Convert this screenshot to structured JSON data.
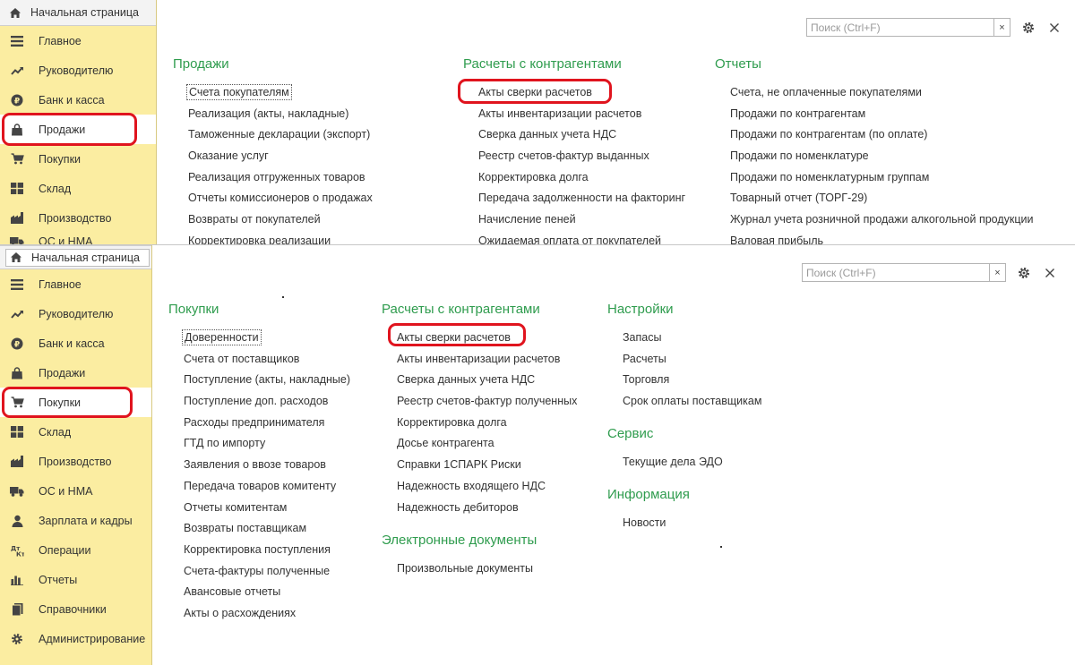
{
  "common": {
    "home_label": "Начальная страница",
    "search_placeholder": "Поиск (Ctrl+F)",
    "clear_glyph": "×",
    "accent_green": "#2f9c4e",
    "sidebar_bg": "#fbeda1",
    "highlight_red": "#e0141e"
  },
  "top": {
    "sidebar": [
      {
        "label": "Главное",
        "icon": "menu-icon"
      },
      {
        "label": "Руководителю",
        "icon": "trend-icon"
      },
      {
        "label": "Банк и касса",
        "icon": "coin-icon"
      },
      {
        "label": "Продажи",
        "icon": "shopping-bag-icon",
        "active": true
      },
      {
        "label": "Покупки",
        "icon": "cart-icon"
      },
      {
        "label": "Склад",
        "icon": "warehouse-icon"
      },
      {
        "label": "Производство",
        "icon": "factory-icon"
      },
      {
        "label": "ОС и НМА",
        "icon": "truck-icon"
      }
    ],
    "sections": [
      {
        "title": "Продажи",
        "links": [
          "Счета покупателям",
          "Реализация (акты, накладные)",
          "Таможенные декларации (экспорт)",
          "Оказание услуг",
          "Реализация отгруженных товаров",
          "Отчеты комиссионеров о продажах",
          "Возвраты от покупателей",
          "Корректировка реализации"
        ]
      },
      {
        "title": "Расчеты с контрагентами",
        "links": [
          "Акты сверки расчетов",
          "Акты инвентаризации расчетов",
          "Сверка данных учета НДС",
          "Реестр счетов-фактур выданных",
          "Корректировка долга",
          "Передача задолженности на факторинг",
          "Начисление пеней",
          "Ожидаемая оплата от покупателей"
        ]
      },
      {
        "title": "Отчеты",
        "links": [
          "Счета, не оплаченные покупателями",
          "Продажи по контрагентам",
          "Продажи по контрагентам (по оплате)",
          "Продажи по номенклатуре",
          "Продажи по номенклатурным группам",
          "Товарный отчет (ТОРГ-29)",
          "Журнал учета розничной продажи алкогольной продукции",
          "Валовая прибыль"
        ]
      }
    ]
  },
  "bottom": {
    "sidebar": [
      {
        "label": "Главное",
        "icon": "menu-icon"
      },
      {
        "label": "Руководителю",
        "icon": "trend-icon"
      },
      {
        "label": "Банк и касса",
        "icon": "coin-icon"
      },
      {
        "label": "Продажи",
        "icon": "shopping-bag-icon"
      },
      {
        "label": "Покупки",
        "icon": "cart-icon",
        "active": true
      },
      {
        "label": "Склад",
        "icon": "warehouse-icon"
      },
      {
        "label": "Производство",
        "icon": "factory-icon"
      },
      {
        "label": "ОС и НМА",
        "icon": "truck-icon"
      },
      {
        "label": "Зарплата и кадры",
        "icon": "person-icon"
      },
      {
        "label": "Операции",
        "icon": "debit-credit-icon"
      },
      {
        "label": "Отчеты",
        "icon": "bar-chart-icon"
      },
      {
        "label": "Справочники",
        "icon": "book-icon"
      },
      {
        "label": "Администрирование",
        "icon": "settings-icon"
      }
    ],
    "sections": [
      {
        "title": "Покупки",
        "links": [
          "Доверенности",
          "Счета от поставщиков",
          "Поступление (акты, накладные)",
          "Поступление доп. расходов",
          "Расходы предпринимателя",
          "ГТД по импорту",
          "Заявления о ввозе товаров",
          "Передача товаров комитенту",
          "Отчеты комитентам",
          "Возвраты поставщикам",
          "Корректировка поступления",
          "Счета-фактуры полученные",
          "Авансовые отчеты",
          "Акты о расхождениях"
        ]
      },
      {
        "title": "Расчеты с контрагентами",
        "links": [
          "Акты сверки расчетов",
          "Акты инвентаризации расчетов",
          "Сверка данных учета НДС",
          "Реестр счетов-фактур полученных",
          "Корректировка долга",
          "Досье контрагента",
          "Справки 1СПАРК Риски",
          "Надежность входящего НДС",
          "Надежность дебиторов"
        ]
      },
      {
        "title": "Электронные документы",
        "links": [
          "Произвольные документы"
        ]
      },
      {
        "title": "Настройки",
        "links": [
          "Запасы",
          "Расчеты",
          "Торговля",
          "Срок оплаты поставщикам"
        ]
      },
      {
        "title": "Сервис",
        "links": [
          "Текущие дела ЭДО"
        ]
      },
      {
        "title": "Информация",
        "links": [
          "Новости"
        ]
      }
    ]
  }
}
